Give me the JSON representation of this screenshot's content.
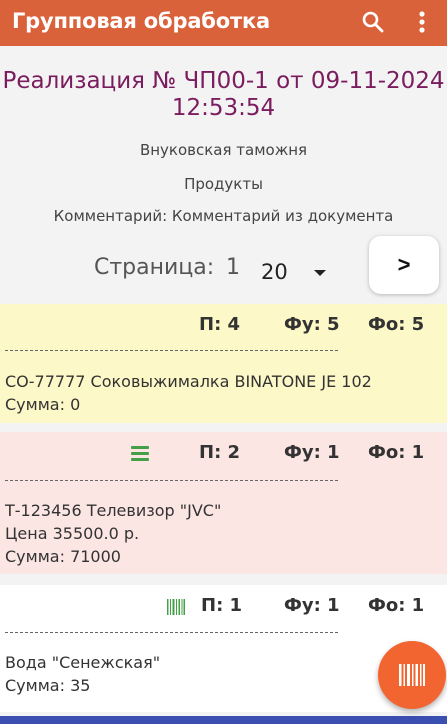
{
  "appbar": {
    "title": "Групповая обработка",
    "search_icon": "search-icon",
    "menu_icon": "more-vertical-icon"
  },
  "document": {
    "title_line1": "Реализация № ЧП00-1 от 09-11-2024",
    "title_line2": "12:53:54",
    "warehouse": "Внуковская таможня",
    "category": "Продукты",
    "comment": "Комментарий: Комментарий из документа"
  },
  "pager": {
    "label": "Страница:",
    "page": "1",
    "per_page": "20",
    "next_label": ">"
  },
  "items": [
    {
      "p": "П: 4",
      "fu": "Фу: 5",
      "fo": "Фо: 5",
      "name": "СО-77777 Соковыжималка BINATONE JE 102",
      "sum": "Сумма: 0",
      "bg": "#fdf8c7"
    },
    {
      "p": "П: 2",
      "fu": "Фу: 1",
      "fo": "Фо: 1",
      "name": "Т-123456 Телевизор \"JVC\"",
      "price": "Цена 35500.0 р.",
      "sum": "Сумма: 71000",
      "bg": "#fbe6e3",
      "icon": "list-lines-icon"
    },
    {
      "p": "П: 1",
      "fu": "Фу: 1",
      "fo": "Фо: 1",
      "name": "Вода \"Сенежская\"",
      "sum": "Сумма: 35",
      "bg": "#ffffff",
      "icon": "barcode-icon"
    }
  ],
  "fab": {
    "icon": "barcode-scan-icon"
  },
  "colors": {
    "appbar": "#d9623a",
    "title": "#7a1c5e",
    "fab": "#f26530",
    "green_icon": "#43a047"
  }
}
